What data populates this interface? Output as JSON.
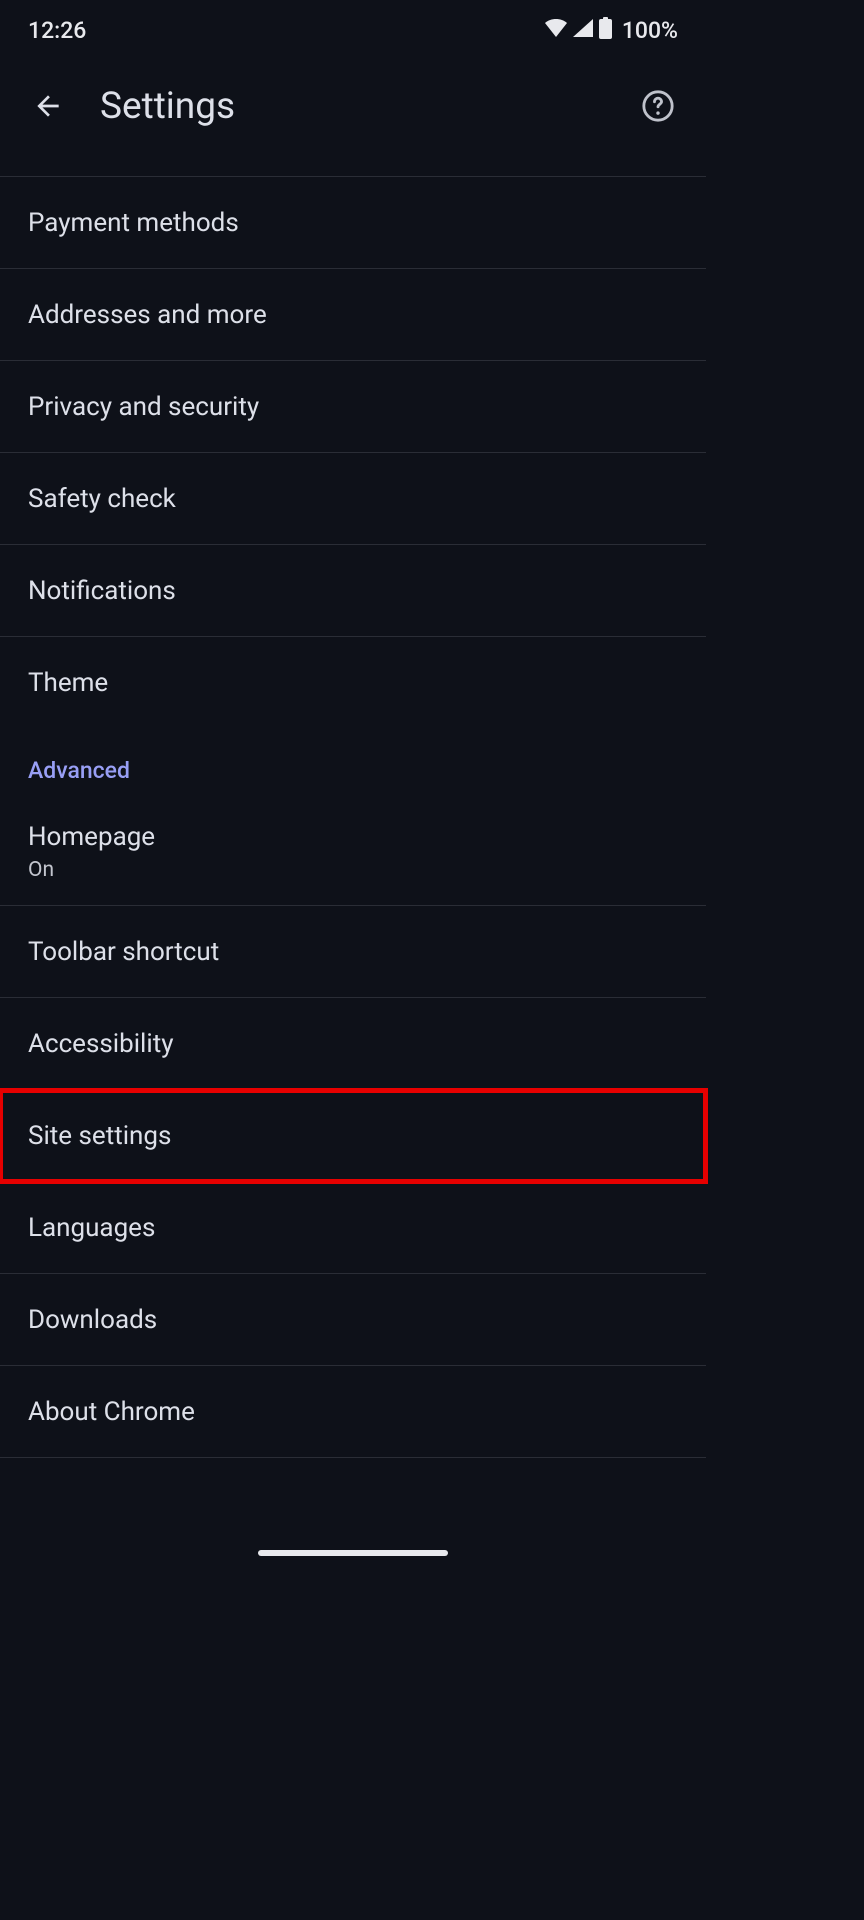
{
  "statusBar": {
    "time": "12:26",
    "battery": "100%"
  },
  "appBar": {
    "title": "Settings"
  },
  "sectionHeaders": {
    "advanced": "Advanced"
  },
  "items": {
    "paymentMethods": "Payment methods",
    "addresses": "Addresses and more",
    "privacy": "Privacy and security",
    "safetyCheck": "Safety check",
    "notifications": "Notifications",
    "theme": "Theme",
    "homepage": "Homepage",
    "homepageSub": "On",
    "toolbar": "Toolbar shortcut",
    "accessibility": "Accessibility",
    "siteSettings": "Site settings",
    "languages": "Languages",
    "downloads": "Downloads",
    "aboutChrome": "About Chrome"
  }
}
